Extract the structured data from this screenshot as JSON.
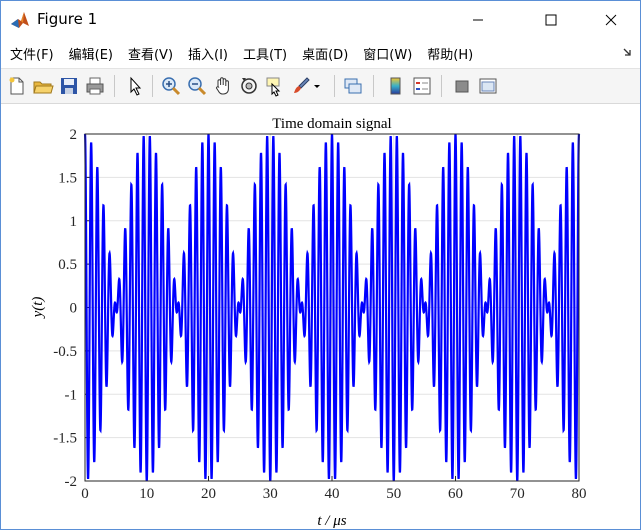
{
  "window": {
    "title": "Figure 1",
    "controls": [
      "minimize",
      "maximize",
      "close"
    ]
  },
  "menu": {
    "items": [
      "文件(F)",
      "编辑(E)",
      "查看(V)",
      "插入(I)",
      "工具(T)",
      "桌面(D)",
      "窗口(W)",
      "帮助(H)"
    ]
  },
  "toolbar": {
    "buttons": [
      {
        "name": "new-figure-icon"
      },
      {
        "name": "open-file-icon"
      },
      {
        "name": "save-icon"
      },
      {
        "name": "print-icon"
      },
      {
        "name": "pointer-icon"
      },
      {
        "name": "zoom-in-icon"
      },
      {
        "name": "zoom-out-icon"
      },
      {
        "name": "pan-hand-icon"
      },
      {
        "name": "rotate-3d-icon"
      },
      {
        "name": "data-cursor-icon"
      },
      {
        "name": "brush-icon"
      },
      {
        "name": "link-plot-icon"
      },
      {
        "name": "colorbar-icon"
      },
      {
        "name": "legend-icon"
      },
      {
        "name": "hide-plot-tools-icon"
      },
      {
        "name": "show-plot-tools-icon"
      }
    ]
  },
  "chart_data": {
    "type": "line",
    "title": "Time domain signal",
    "xlabel": "t / μs",
    "ylabel": "y(t)",
    "xlim": [
      0,
      80
    ],
    "ylim": [
      -2,
      2
    ],
    "xticks": [
      "0",
      "10",
      "20",
      "30",
      "40",
      "50",
      "60",
      "70",
      "80"
    ],
    "yticks": [
      "2",
      "1.5",
      "1",
      "0.5",
      "0",
      "-0.5",
      "-1",
      "-1.5",
      "-2"
    ],
    "grid": true,
    "series": [
      {
        "color": "#0000ff",
        "function": "y = 2·cos(2π·0.025·t)·cos(2π·t)",
        "envelope_amplitude": 2,
        "envelope_period": 20,
        "carrier_period": 1
      }
    ]
  }
}
